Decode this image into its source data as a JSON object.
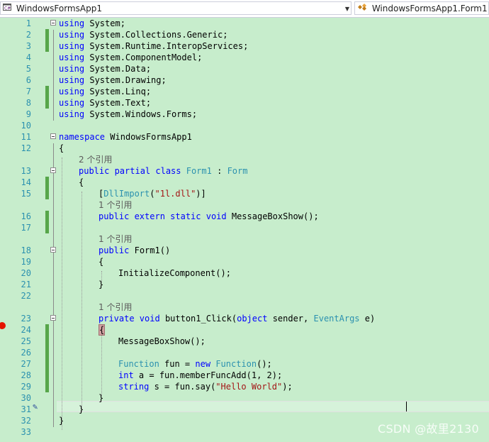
{
  "navigation": {
    "project_dropdown": "WindowsFormsApp1",
    "type_dropdown": "WindowsFormsApp1.Form1"
  },
  "editor": {
    "lines": [
      {
        "n": "1",
        "ind": 0,
        "segs": [
          [
            "kw",
            "using"
          ],
          [
            "",
            "System;"
          ]
        ]
      },
      {
        "n": "2",
        "ind": 0,
        "segs": [
          [
            "kw",
            "using"
          ],
          [
            "",
            "System.Collections.Generic;"
          ]
        ]
      },
      {
        "n": "3",
        "ind": 0,
        "segs": [
          [
            "kw",
            "using"
          ],
          [
            "",
            "System.Runtime.InteropServices;"
          ]
        ]
      },
      {
        "n": "4",
        "ind": 0,
        "segs": [
          [
            "kw",
            "using"
          ],
          [
            "",
            "System.ComponentModel;"
          ]
        ]
      },
      {
        "n": "5",
        "ind": 0,
        "segs": [
          [
            "kw",
            "using"
          ],
          [
            "",
            "System.Data;"
          ]
        ]
      },
      {
        "n": "6",
        "ind": 0,
        "segs": [
          [
            "kw",
            "using"
          ],
          [
            "",
            "System.Drawing;"
          ]
        ]
      },
      {
        "n": "7",
        "ind": 0,
        "segs": [
          [
            "kw",
            "using"
          ],
          [
            "",
            "System.Linq;"
          ]
        ]
      },
      {
        "n": "8",
        "ind": 0,
        "segs": [
          [
            "kw",
            "using"
          ],
          [
            "",
            "System.Text;"
          ]
        ]
      },
      {
        "n": "9",
        "ind": 0,
        "segs": [
          [
            "kw",
            "using"
          ],
          [
            "",
            "System.Windows.Forms;"
          ]
        ]
      },
      {
        "n": "10",
        "ind": 0,
        "segs": []
      },
      {
        "n": "11",
        "ind": 0,
        "segs": [
          [
            "kw",
            "namespace"
          ],
          [
            "",
            "WindowsFormsApp1"
          ]
        ]
      },
      {
        "n": "12",
        "ind": 0,
        "segs": [
          [
            "",
            "{"
          ]
        ]
      },
      {
        "ref": "2 个引用",
        "ind": 1
      },
      {
        "n": "13",
        "ind": 1,
        "segs": [
          [
            "kw",
            "public partial class"
          ],
          [
            "ty",
            "Form1"
          ],
          [
            "",
            ":"
          ],
          [
            "ty",
            "Form"
          ]
        ]
      },
      {
        "n": "14",
        "ind": 1,
        "segs": [
          [
            "",
            "{"
          ]
        ]
      },
      {
        "n": "15",
        "ind": 2,
        "segs": [
          [
            "",
            "["
          ],
          [
            "ty",
            "DllImport"
          ],
          [
            "",
            "("
          ],
          [
            "str",
            "\"1l.dll\""
          ],
          [
            "",
            ")]"
          ]
        ]
      },
      {
        "ref": "1 个引用",
        "ind": 2
      },
      {
        "n": "16",
        "ind": 2,
        "segs": [
          [
            "kw",
            "public extern static void"
          ],
          [
            "",
            "MessageBoxShow();"
          ]
        ]
      },
      {
        "n": "17",
        "ind": 2,
        "segs": []
      },
      {
        "ref": "1 个引用",
        "ind": 2
      },
      {
        "n": "18",
        "ind": 2,
        "segs": [
          [
            "kw",
            "public"
          ],
          [
            "",
            "Form1()"
          ]
        ]
      },
      {
        "n": "19",
        "ind": 2,
        "segs": [
          [
            "",
            "{"
          ]
        ]
      },
      {
        "n": "20",
        "ind": 3,
        "segs": [
          [
            "",
            "InitializeComponent();"
          ]
        ]
      },
      {
        "n": "21",
        "ind": 2,
        "segs": [
          [
            "",
            "}"
          ]
        ]
      },
      {
        "n": "22",
        "ind": 2,
        "segs": []
      },
      {
        "ref": "1 个引用",
        "ind": 2
      },
      {
        "n": "23",
        "ind": 2,
        "segs": [
          [
            "kw",
            "private void"
          ],
          [
            "",
            "button1_Click("
          ],
          [
            "kw",
            "object"
          ],
          [
            "",
            "sender,"
          ],
          [
            "ty",
            "EventArgs"
          ],
          [
            "",
            "e)"
          ]
        ]
      },
      {
        "n": "24",
        "ind": 2,
        "segs": [
          [
            "",
            "{"
          ]
        ]
      },
      {
        "n": "25",
        "ind": 3,
        "segs": [
          [
            "",
            "MessageBoxShow();"
          ]
        ]
      },
      {
        "n": "26",
        "ind": 3,
        "segs": []
      },
      {
        "n": "27",
        "ind": 3,
        "segs": [
          [
            "ty",
            "Function"
          ],
          [
            "",
            "fun ="
          ],
          [
            "kw",
            "new"
          ],
          [
            "ty",
            "Function"
          ],
          [
            "",
            "();"
          ]
        ]
      },
      {
        "n": "28",
        "ind": 3,
        "segs": [
          [
            "kw",
            "int"
          ],
          [
            "",
            "a = fun.memberFuncAdd(1, 2);"
          ]
        ]
      },
      {
        "n": "29",
        "ind": 3,
        "segs": [
          [
            "kw",
            "string"
          ],
          [
            "",
            "s = fun.say("
          ],
          [
            "str",
            "\"Hello World\""
          ],
          [
            "",
            ");"
          ]
        ]
      },
      {
        "n": "30",
        "ind": 2,
        "segs": [
          [
            "",
            "}"
          ]
        ]
      },
      {
        "n": "31",
        "ind": 1,
        "segs": [
          [
            "",
            "}"
          ]
        ]
      },
      {
        "n": "32",
        "ind": 0,
        "segs": [
          [
            "",
            "}"
          ]
        ]
      },
      {
        "n": "33",
        "ind": 0,
        "segs": []
      }
    ]
  },
  "watermark": "CSDN @故里2130",
  "colors": {
    "keyword": "#0000ff",
    "type": "#2b91af",
    "string": "#a31515",
    "background": "#c7edcc",
    "changed": "#57a64a"
  }
}
